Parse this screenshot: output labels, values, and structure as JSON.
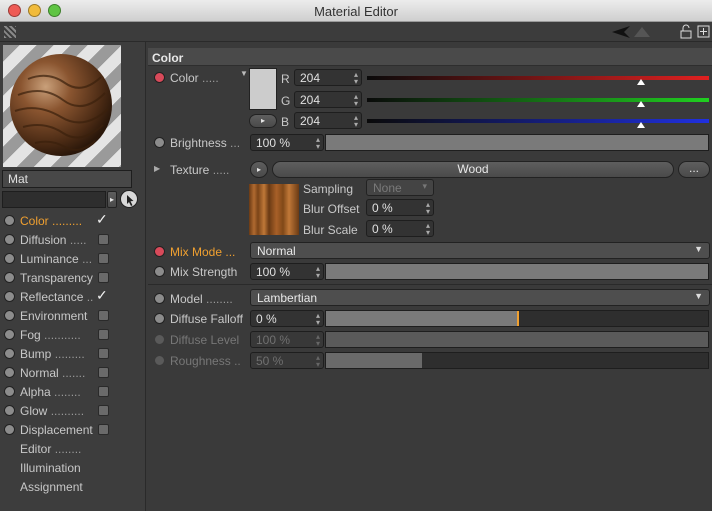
{
  "window": {
    "title": "Material Editor"
  },
  "material": {
    "name": "Mat"
  },
  "channels": [
    {
      "label": "Color",
      "dots": ".........",
      "enabled": true,
      "active": true
    },
    {
      "label": "Diffusion",
      "dots": ".....",
      "enabled": false,
      "active": false
    },
    {
      "label": "Luminance",
      "dots": "...",
      "enabled": false,
      "active": false
    },
    {
      "label": "Transparency",
      "dots": "",
      "enabled": false,
      "active": false
    },
    {
      "label": "Reflectance",
      "dots": "..",
      "enabled": true,
      "active": false
    },
    {
      "label": "Environment",
      "dots": "",
      "enabled": false,
      "active": false
    },
    {
      "label": "Fog",
      "dots": "...........",
      "enabled": false,
      "active": false
    },
    {
      "label": "Bump",
      "dots": ".........",
      "enabled": false,
      "active": false
    },
    {
      "label": "Normal",
      "dots": ".......",
      "enabled": false,
      "active": false
    },
    {
      "label": "Alpha",
      "dots": "........",
      "enabled": false,
      "active": false
    },
    {
      "label": "Glow",
      "dots": "..........",
      "enabled": false,
      "active": false
    },
    {
      "label": "Displacement",
      "dots": "",
      "enabled": false,
      "active": false
    }
  ],
  "extra_items": [
    {
      "label": "Editor",
      "dots": "........"
    },
    {
      "label": "Illumination",
      "dots": ""
    },
    {
      "label": "Assignment",
      "dots": ""
    }
  ],
  "section": {
    "title": "Color"
  },
  "color": {
    "label": "Color",
    "dots": ".....",
    "swatch": "#cccccc",
    "r": {
      "label": "R",
      "value": "204",
      "fraction": 0.8
    },
    "g": {
      "label": "G",
      "value": "204",
      "fraction": 0.8
    },
    "b": {
      "label": "B",
      "value": "204",
      "fraction": 0.8
    }
  },
  "brightness": {
    "label": "Brightness",
    "dots": "...",
    "value": "100 %",
    "fraction": 1.0
  },
  "texture": {
    "label": "Texture",
    "dots": ".....",
    "name": "Wood",
    "more": "...",
    "sampling": {
      "label": "Sampling",
      "value": "None"
    },
    "blur_offset": {
      "label": "Blur Offset",
      "value": "0 %"
    },
    "blur_scale": {
      "label": "Blur Scale",
      "value": "0 %"
    }
  },
  "mix_mode": {
    "label": "Mix Mode",
    "dots": "...",
    "value": "Normal"
  },
  "mix_strength": {
    "label": "Mix Strength",
    "value": "100 %",
    "fraction": 1.0
  },
  "model": {
    "label": "Model",
    "dots": "........",
    "value": "Lambertian"
  },
  "diffuse_falloff": {
    "label": "Diffuse Falloff",
    "value": "0 %",
    "fraction": 0.5
  },
  "diffuse_level": {
    "label": "Diffuse Level",
    "value": "100 %",
    "fraction": 1.0
  },
  "roughness": {
    "label": "Roughness",
    "dots": "..",
    "value": "50 %",
    "fraction": 0.25
  },
  "colors": {
    "accent_orange": "#f0a030",
    "active_radio": "#d84a5a",
    "red": "#d03030",
    "green": "#30c030",
    "blue": "#3040d0"
  }
}
